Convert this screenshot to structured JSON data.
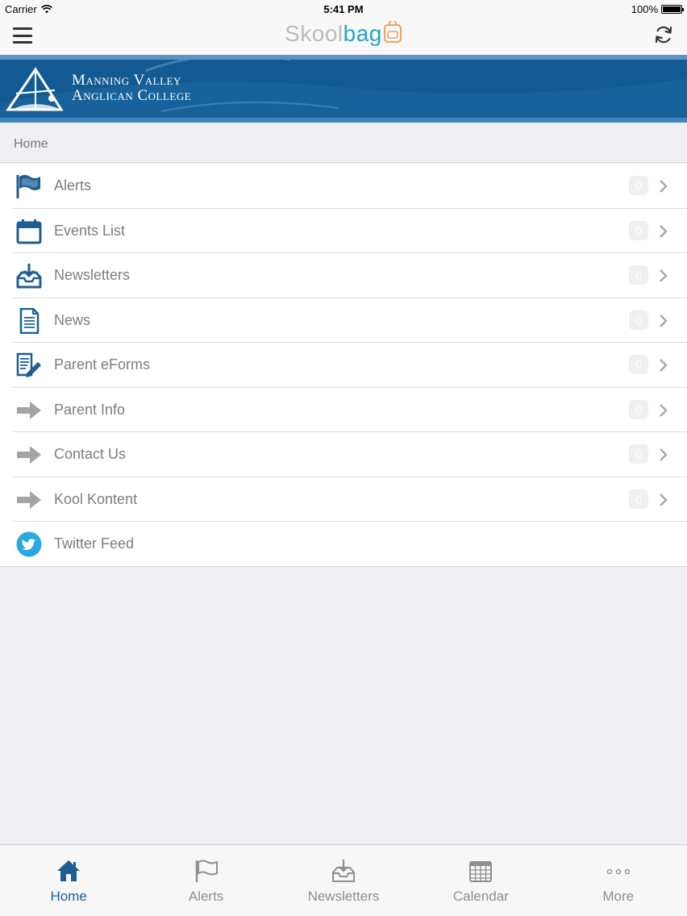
{
  "status_bar": {
    "carrier": "Carrier",
    "time": "5:41 PM",
    "battery": "100%",
    "battery_level": 1.0
  },
  "nav": {
    "logo_part1": "Skool",
    "logo_part2": "bag",
    "menu_icon": "hamburger-icon",
    "refresh_icon": "refresh-icon"
  },
  "banner": {
    "line1": "Manning Valley",
    "line2": "Anglican College",
    "bg_color": "#145a92"
  },
  "breadcrumb": "Home",
  "menu": {
    "items": [
      {
        "label": "Alerts",
        "icon": "flag-icon",
        "badge": "0"
      },
      {
        "label": "Events List",
        "icon": "calendar-icon",
        "badge": "0"
      },
      {
        "label": "Newsletters",
        "icon": "inbox-download-icon",
        "badge": "0"
      },
      {
        "label": "News",
        "icon": "document-icon",
        "badge": "0"
      },
      {
        "label": "Parent eForms",
        "icon": "form-edit-icon",
        "badge": "0"
      },
      {
        "label": "Parent Info",
        "icon": "arrow-right-icon",
        "badge": "0"
      },
      {
        "label": "Contact Us",
        "icon": "arrow-right-icon",
        "badge": "0"
      },
      {
        "label": "Kool Kontent",
        "icon": "arrow-right-icon",
        "badge": "0"
      },
      {
        "label": "Twitter Feed",
        "icon": "twitter-icon"
      }
    ]
  },
  "tabs": [
    {
      "label": "Home",
      "icon": "home-icon",
      "active": true
    },
    {
      "label": "Alerts",
      "icon": "flag-icon"
    },
    {
      "label": "Newsletters",
      "icon": "inbox-download-icon"
    },
    {
      "label": "Calendar",
      "icon": "calendar-grid-icon"
    },
    {
      "label": "More",
      "icon": "more-dots-icon"
    }
  ],
  "colors": {
    "accent": "#1c5f95",
    "twitter": "#2aa9e0",
    "logo_blue": "#29a3c8",
    "logo_gray": "#b9bcc0"
  }
}
